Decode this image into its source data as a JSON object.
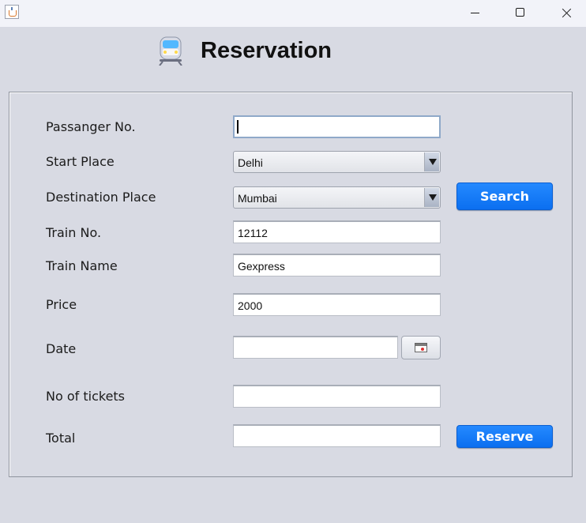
{
  "window": {
    "minimize_icon": "minimize-icon",
    "maximize_icon": "maximize-icon",
    "close_icon": "close-icon",
    "app_icon": "java-cup-icon"
  },
  "header": {
    "title": "Reservation",
    "icon": "train-icon"
  },
  "form": {
    "passenger_no": {
      "label": "Passanger No.",
      "value": ""
    },
    "start_place": {
      "label": "Start Place",
      "value": "Delhi"
    },
    "destination_place": {
      "label": "Destination Place",
      "value": "Mumbai"
    },
    "train_no": {
      "label": "Train No.",
      "value": "12112"
    },
    "train_name": {
      "label": "Train Name",
      "value": "Gexpress"
    },
    "price": {
      "label": "Price",
      "value": "2000"
    },
    "date": {
      "label": "Date",
      "value": "",
      "button_icon": "calendar-icon"
    },
    "no_of_tickets": {
      "label": "No of tickets",
      "value": ""
    },
    "total": {
      "label": "Total",
      "value": ""
    }
  },
  "buttons": {
    "search": "Search",
    "reserve": "Reserve"
  },
  "colors": {
    "accent": "#167cf8",
    "background": "#d8dae3"
  }
}
